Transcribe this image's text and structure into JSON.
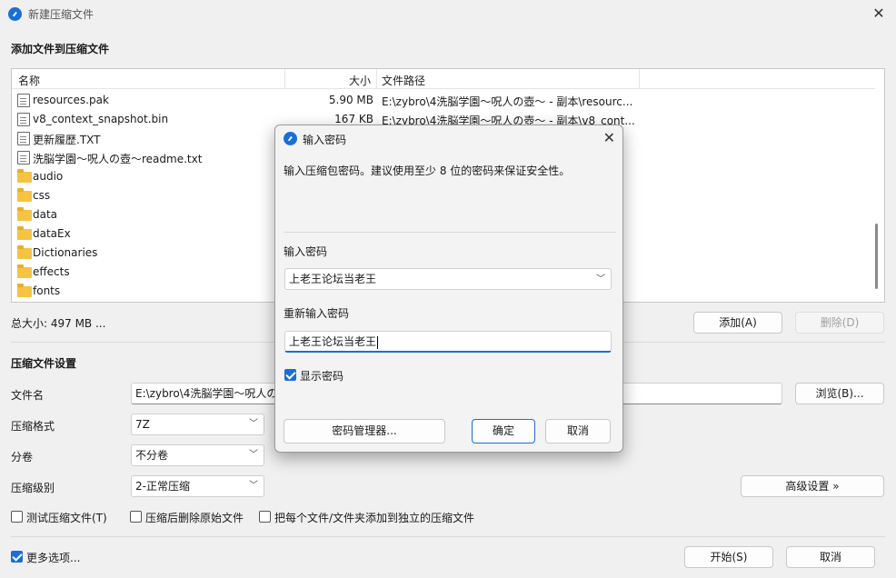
{
  "window": {
    "title": "新建压缩文件"
  },
  "add_section": {
    "title": "添加文件到压缩文件"
  },
  "list": {
    "columns": [
      "名称",
      "大小",
      "文件路径"
    ],
    "rows": [
      {
        "type": "file",
        "name": "resources.pak",
        "size": "5.90 MB",
        "path": "E:\\zybro\\4洗脳学園～呪人の壺～ - 副本\\resourc..."
      },
      {
        "type": "file",
        "name": "v8_context_snapshot.bin",
        "size": "167 KB",
        "path": "E:\\zybro\\4洗脳学園～呪人の壺～ - 副本\\v8_cont..."
      },
      {
        "type": "file",
        "name": "更新履歴.TXT",
        "size": "",
        "path": ""
      },
      {
        "type": "file",
        "name": "洗脳学園～呪人の壺～readme.txt",
        "size": "",
        "path": ""
      },
      {
        "type": "folder",
        "name": "audio",
        "size": "",
        "path": ""
      },
      {
        "type": "folder",
        "name": "css",
        "size": "",
        "path": ""
      },
      {
        "type": "folder",
        "name": "data",
        "size": "",
        "path": ""
      },
      {
        "type": "folder",
        "name": "dataEx",
        "size": "",
        "path": ""
      },
      {
        "type": "folder",
        "name": "Dictionaries",
        "size": "",
        "path": ""
      },
      {
        "type": "folder",
        "name": "effects",
        "size": "",
        "path": ""
      },
      {
        "type": "folder",
        "name": "fonts",
        "size": "",
        "path": ""
      }
    ]
  },
  "total_size": "总大小: 497 MB ...",
  "buttons": {
    "add": "添加(A)",
    "delete": "删除(D)",
    "browse": "浏览(B)...",
    "advanced": "高级设置 »",
    "start": "开始(S)",
    "cancel": "取消"
  },
  "settings": {
    "title": "压缩文件设置",
    "filename_label": "文件名",
    "filename_value": "E:\\zybro\\4洗脳学園～呪人の",
    "format_label": "压缩格式",
    "format_value": "7Z",
    "volume_label": "分卷",
    "volume_value": "不分卷",
    "level_label": "压缩级别",
    "level_value": "2-正常压缩"
  },
  "options": {
    "test": "测试压缩文件(T)",
    "delete_after": "压缩后删除原始文件",
    "separate": "把每个文件/文件夹添加到独立的压缩文件",
    "more": "更多选项..."
  },
  "dialog": {
    "title": "输入密码",
    "hint": "输入压缩包密码。建议使用至少 8 位的密码来保证安全性。",
    "password_label": "输入密码",
    "password_value": "上老王论坛当老王",
    "confirm_label": "重新输入密码",
    "confirm_value": "上老王论坛当老王",
    "show_password": "显示密码",
    "manager": "密码管理器...",
    "ok": "确定",
    "cancel": "取消"
  },
  "colors": {
    "accent": "#1a6fd6",
    "folder": "#f6c342"
  }
}
